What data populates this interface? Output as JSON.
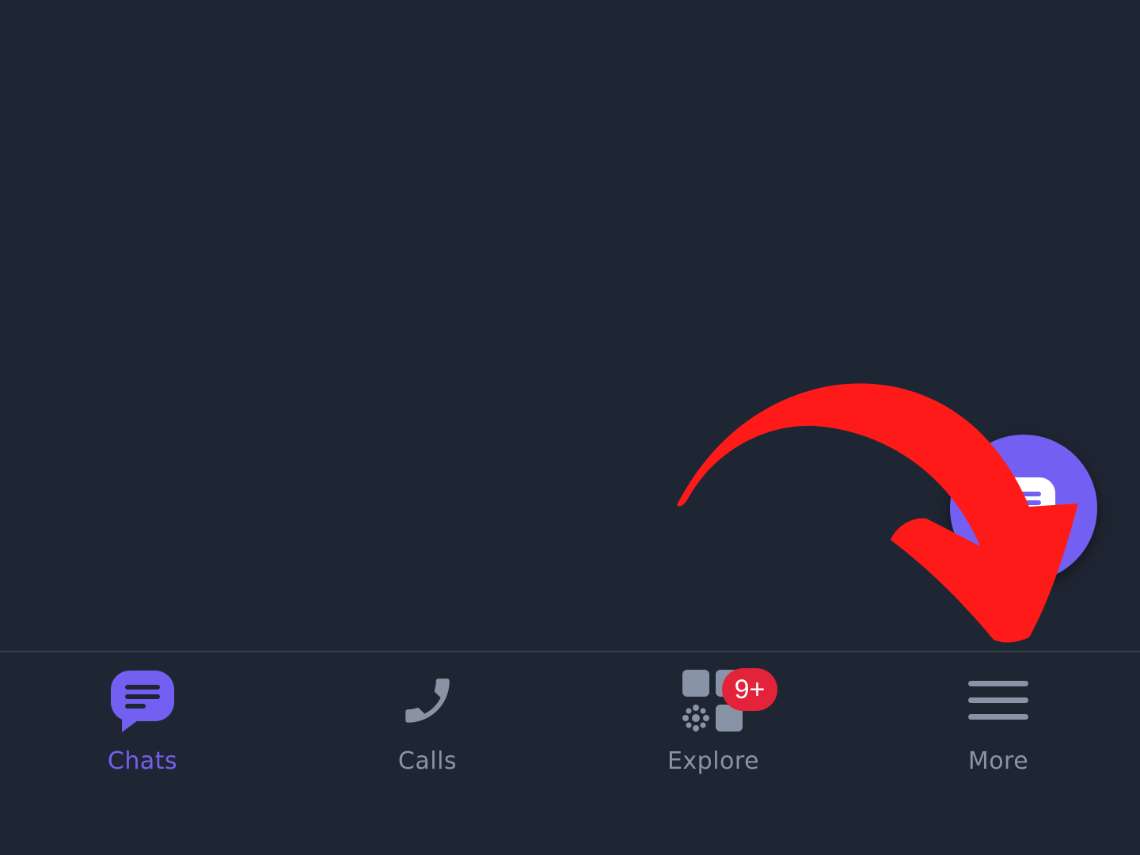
{
  "colors": {
    "background": "#1f2633",
    "accent": "#7360f2",
    "inactive": "#8894a5",
    "divider": "#343d4b",
    "badge": "#e2233a",
    "annotation": "#ff1a1a"
  },
  "fab": {
    "icon": "compose-chat-icon"
  },
  "nav": {
    "items": [
      {
        "id": "chats",
        "label": "Chats",
        "icon": "chat-bubble-icon",
        "active": true
      },
      {
        "id": "calls",
        "label": "Calls",
        "icon": "phone-icon",
        "active": false
      },
      {
        "id": "explore",
        "label": "Explore",
        "icon": "explore-grid-icon",
        "active": false,
        "badge": "9+"
      },
      {
        "id": "more",
        "label": "More",
        "icon": "hamburger-menu-icon",
        "active": false
      }
    ]
  },
  "annotation": {
    "icon": "curved-arrow-icon",
    "points_to": "more"
  }
}
